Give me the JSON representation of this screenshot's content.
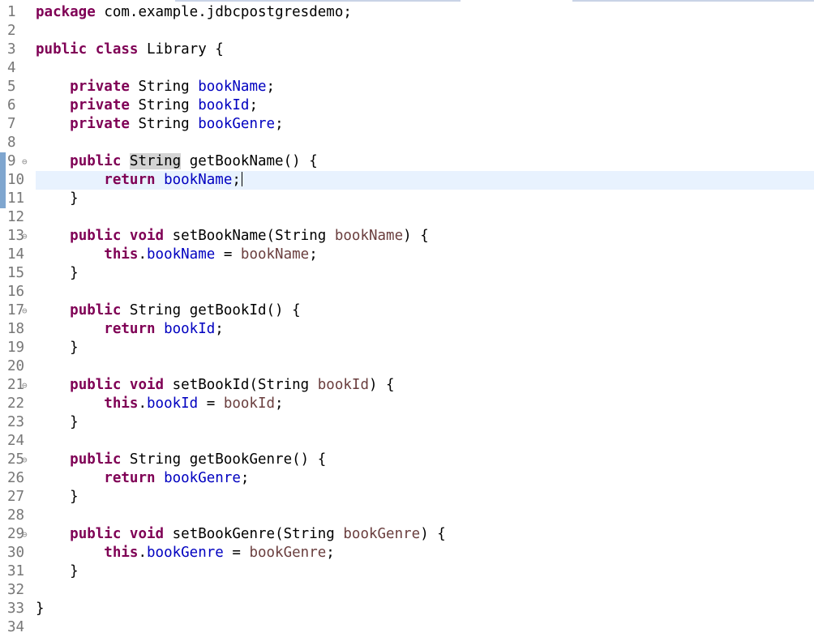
{
  "editor": {
    "file_kind": "Java source",
    "lines": [
      {
        "n": "1",
        "code": "package com.example.jdbcpostgresdemo;"
      },
      {
        "n": "2",
        "code": ""
      },
      {
        "n": "3",
        "code": "public class Library {"
      },
      {
        "n": "4",
        "code": ""
      },
      {
        "n": "5",
        "code": "    private String bookName;"
      },
      {
        "n": "6",
        "code": "    private String bookId;"
      },
      {
        "n": "7",
        "code": "    private String bookGenre;"
      },
      {
        "n": "8",
        "code": ""
      },
      {
        "n": "9",
        "code": "    public String getBookName() {"
      },
      {
        "n": "10",
        "code": "        return bookName;"
      },
      {
        "n": "11",
        "code": "    }"
      },
      {
        "n": "12",
        "code": ""
      },
      {
        "n": "13",
        "code": "    public void setBookName(String bookName) {"
      },
      {
        "n": "14",
        "code": "        this.bookName = bookName;"
      },
      {
        "n": "15",
        "code": "    }"
      },
      {
        "n": "16",
        "code": ""
      },
      {
        "n": "17",
        "code": "    public String getBookId() {"
      },
      {
        "n": "18",
        "code": "        return bookId;"
      },
      {
        "n": "19",
        "code": "    }"
      },
      {
        "n": "20",
        "code": ""
      },
      {
        "n": "21",
        "code": "    public void setBookId(String bookId) {"
      },
      {
        "n": "22",
        "code": "        this.bookId = bookId;"
      },
      {
        "n": "23",
        "code": "    }"
      },
      {
        "n": "24",
        "code": ""
      },
      {
        "n": "25",
        "code": "    public String getBookGenre() {"
      },
      {
        "n": "26",
        "code": "        return bookGenre;"
      },
      {
        "n": "27",
        "code": "    }"
      },
      {
        "n": "28",
        "code": ""
      },
      {
        "n": "29",
        "code": "    public void setBookGenre(String bookGenre) {"
      },
      {
        "n": "30",
        "code": "        this.bookGenre = bookGenre;"
      },
      {
        "n": "31",
        "code": "    }"
      },
      {
        "n": "32",
        "code": ""
      },
      {
        "n": "33",
        "code": "}"
      },
      {
        "n": "34",
        "code": ""
      }
    ],
    "fold_marker_glyph": "⊖",
    "fold_lines": [
      "9",
      "13",
      "17",
      "21",
      "25",
      "29"
    ],
    "current_line": "10",
    "highlighted_range": [
      "9",
      "10",
      "11"
    ],
    "occurrence_word": "String",
    "occurrence_line": "9",
    "syntax_colors": {
      "keyword": "#7f0055",
      "field": "#0000c0",
      "parameter": "#6a3e3e",
      "line_number": "#777777",
      "current_line_bg": "#e8f2fe",
      "occurrence_bg": "#d4d4d4",
      "range_marker": "#7fa6cf"
    }
  }
}
